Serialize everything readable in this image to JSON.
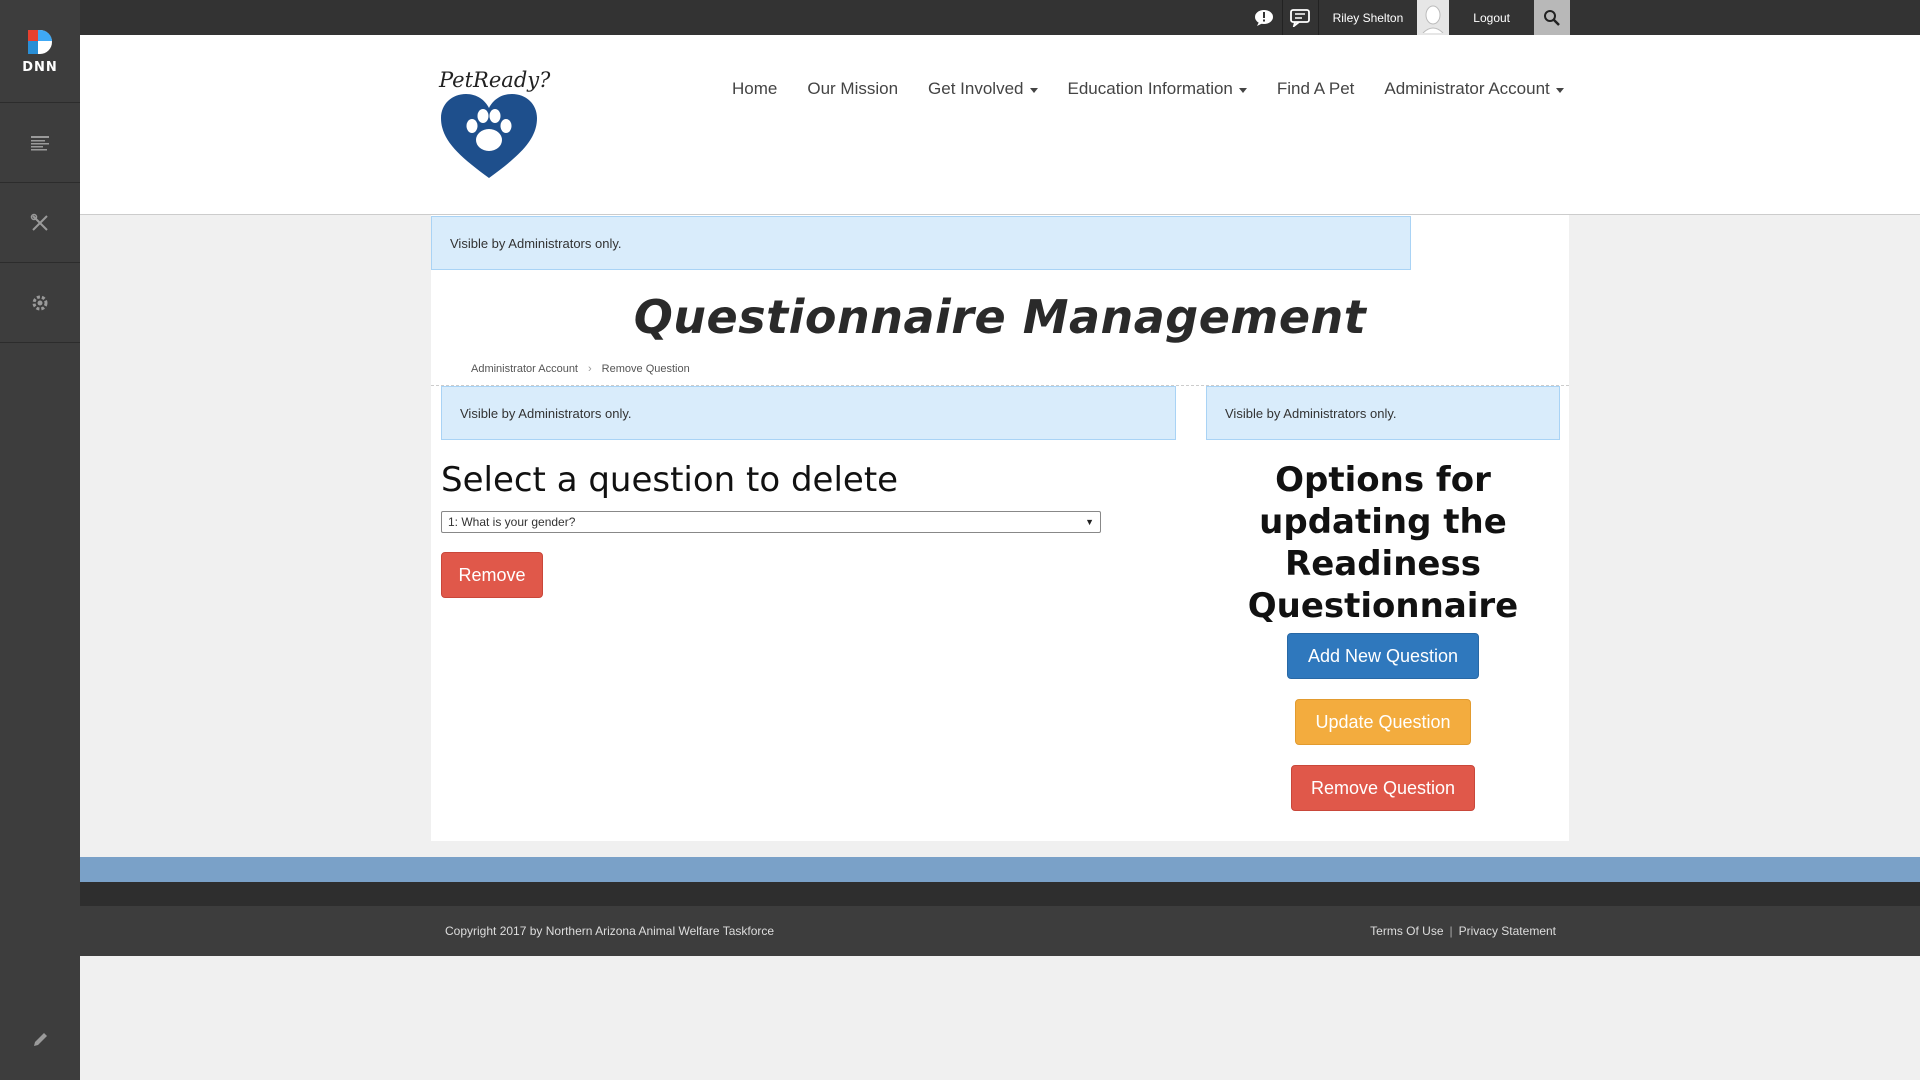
{
  "persona_bar": {
    "logo_text": "DNN",
    "items": [
      "content-icon",
      "tools-icon",
      "settings-icon"
    ],
    "edit_icon": "pencil-icon"
  },
  "topbar": {
    "user_name": "Riley Shelton",
    "logout_label": "Logout"
  },
  "header": {
    "brand": "PetReady?",
    "nav": [
      {
        "label": "Home",
        "dropdown": false
      },
      {
        "label": "Our Mission",
        "dropdown": false
      },
      {
        "label": "Get Involved",
        "dropdown": true
      },
      {
        "label": "Education Information",
        "dropdown": true
      },
      {
        "label": "Find A Pet",
        "dropdown": false
      },
      {
        "label": "Administrator Account",
        "dropdown": true
      }
    ]
  },
  "content": {
    "admin_note": "Visible by Administrators only.",
    "page_title": "Questionnaire Management",
    "breadcrumb": [
      "Administrator Account",
      "Remove Question"
    ],
    "left": {
      "admin_note": "Visible by Administrators only.",
      "heading": "Select a question to delete",
      "selected_question": "1: What is your gender?",
      "remove_label": "Remove"
    },
    "right": {
      "admin_note": "Visible by Administrators only.",
      "heading": "Options for updating the Readiness Questionnaire",
      "add_label": "Add New Question",
      "update_label": "Update Question",
      "remove_label": "Remove Question"
    }
  },
  "footer": {
    "copyright": "Copyright 2017 by Northern Arizona Animal Welfare Taskforce",
    "terms": "Terms Of Use",
    "separator": "|",
    "privacy": "Privacy Statement"
  },
  "colors": {
    "primary": "#2f78bd",
    "warning": "#f3ac3e",
    "danger": "#e0584a",
    "info_bg": "#d9ecfb",
    "footer_band": "#7aa1c8"
  }
}
